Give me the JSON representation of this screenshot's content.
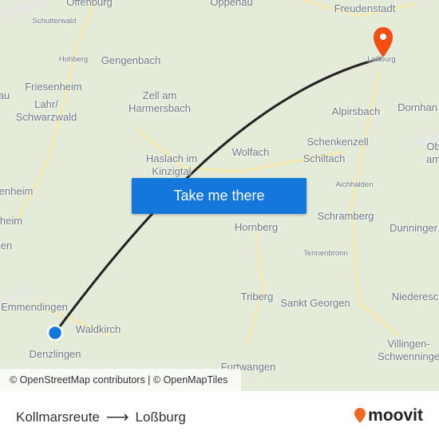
{
  "map": {
    "labels": [
      "Offenburg",
      "Schutterwald",
      "Oppenau",
      "Freudenstadt",
      "Hohberg",
      "Gengenbach",
      "Loßburg",
      "Friesenheim",
      "Zell am\nHarmersbach",
      "Alpirsbach",
      "Dornhan",
      "Lahr/\nSchwarzwald",
      "au",
      "Haslach im\nKinzigtal",
      "Wolfach",
      "Schenkenzell",
      "Schiltach",
      "Ob\nam",
      "Aichhalden",
      "enheim",
      "heim",
      "en",
      "Schramberg",
      "Hornberg",
      "Dunninger",
      "Tennenbronn",
      "Triberg",
      "Sankt Georgen",
      "Niederesc",
      "Emmendingen",
      "Waldkirch",
      "Denzlingen",
      "Villingen-\nSchwenninge",
      "Furtwangen"
    ],
    "origin_marker_color": "#1477dc",
    "destination_marker_color": "#f24d12",
    "route_color": "#222222",
    "attribution": "© OpenStreetMap contributors | © OpenMapTiles"
  },
  "cta": {
    "label": "Take me there",
    "color": "#1477dc"
  },
  "footer": {
    "origin": "Kollmarsreute",
    "arrow": "⟶",
    "destination": "Loßburg",
    "brand": "moovit",
    "brand_color": "#f26722"
  }
}
